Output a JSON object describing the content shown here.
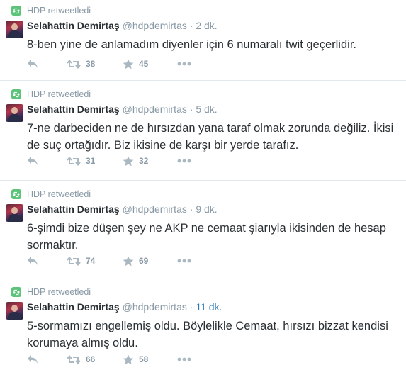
{
  "tweets": [
    {
      "retweet_label": "HDP retweetledi",
      "author_name": "Selahattin Demirtaş",
      "author_handle": "@hdpdemirtas",
      "separator": "·",
      "time": "2 dk.",
      "text": "8-ben yine de anlamadım diyenler için 6 numaralı twit geçerlidir.",
      "retweets": "38",
      "likes": "45"
    },
    {
      "retweet_label": "HDP retweetledi",
      "author_name": "Selahattin Demirtaş",
      "author_handle": "@hdpdemirtas",
      "separator": "·",
      "time": "5 dk.",
      "text": "7-ne darbeciden ne de hırsızdan yana taraf olmak zorunda değiliz. İkisi de suç ortağıdır. Biz ikisine de karşı bir yerde tarafız.",
      "retweets": "31",
      "likes": "32"
    },
    {
      "retweet_label": "HDP retweetledi",
      "author_name": "Selahattin Demirtaş",
      "author_handle": "@hdpdemirtas",
      "separator": "·",
      "time": "9 dk.",
      "text": "6-şimdi bize düşen şey ne AKP ne cemaat şiarıyla ikisinden de hesap sormaktır.",
      "retweets": "74",
      "likes": "69"
    },
    {
      "retweet_label": "HDP retweetledi",
      "author_name": "Selahattin Demirtaş",
      "author_handle": "@hdpdemirtas",
      "separator": "·",
      "time": "11 dk.",
      "text": "5-sormamızı engellemiş oldu. Böylelikle Cemaat, hırsızı bizzat kendisi korumaya almış oldu.",
      "retweets": "66",
      "likes": "58"
    }
  ],
  "icons": {
    "retweet_badge": "retweet-icon",
    "reply": "reply-icon",
    "retweet": "retweet-icon",
    "like": "star-icon",
    "more": "more-dots-icon"
  },
  "colors": {
    "retweet_green": "#5cc47a",
    "muted_gray": "#8899a6",
    "icon_gray": "#aab8c2",
    "link_blue": "#2b7bb9",
    "text": "#292f33"
  }
}
